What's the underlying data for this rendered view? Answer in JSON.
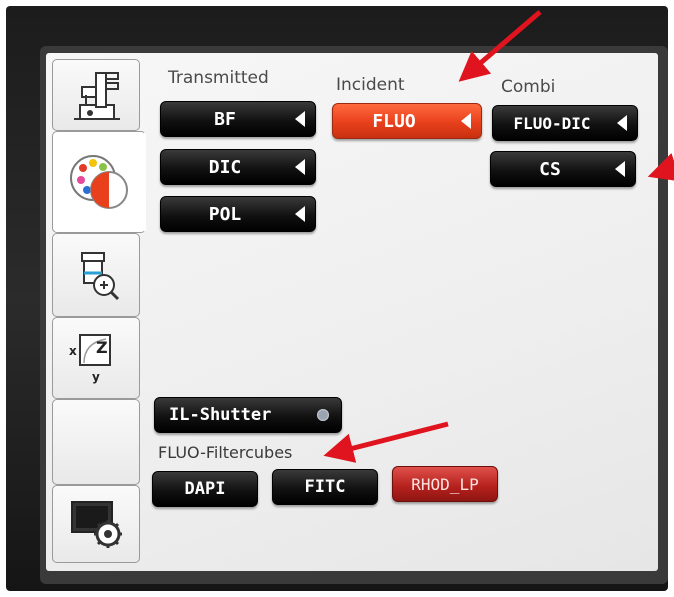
{
  "sidebar": {
    "tabs": [
      {
        "icon": "microscope-icon"
      },
      {
        "icon": "contrast-palette-icon",
        "active": true
      },
      {
        "icon": "objective-zoom-icon"
      },
      {
        "icon": "xyz-stage-icon",
        "x_label": "x",
        "y_label": "y",
        "z_label": "Z"
      },
      {
        "icon": "blank-tab"
      },
      {
        "icon": "screen-settings-icon"
      }
    ]
  },
  "columns": {
    "transmitted": {
      "header": "Transmitted",
      "buttons": [
        "BF",
        "DIC",
        "POL"
      ]
    },
    "incident": {
      "header": "Incident",
      "buttons": [
        "FLUO"
      ],
      "active": "FLUO"
    },
    "combi": {
      "header": "Combi",
      "buttons": [
        "FLUO-DIC",
        "CS"
      ]
    }
  },
  "shutter": {
    "label": "IL-Shutter"
  },
  "filtercubes": {
    "label": "FLUO-Filtercubes",
    "buttons": [
      "DAPI",
      "FITC",
      "RHOD_LP"
    ],
    "active": "RHOD_LP"
  },
  "colors": {
    "accent": "#e8401d",
    "button_dark": "#111111",
    "annotation_arrow": "#e0141e"
  }
}
